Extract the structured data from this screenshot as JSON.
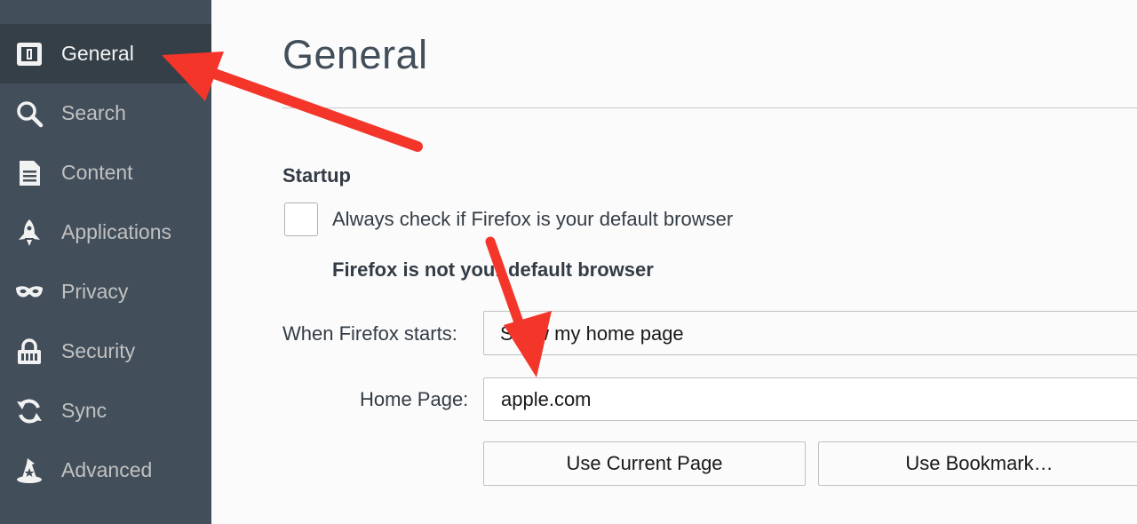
{
  "sidebar": {
    "items": [
      {
        "label": "General",
        "icon": "general-icon",
        "selected": true
      },
      {
        "label": "Search",
        "icon": "search-icon",
        "selected": false
      },
      {
        "label": "Content",
        "icon": "content-icon",
        "selected": false
      },
      {
        "label": "Applications",
        "icon": "rocket-icon",
        "selected": false
      },
      {
        "label": "Privacy",
        "icon": "mask-icon",
        "selected": false
      },
      {
        "label": "Security",
        "icon": "lock-icon",
        "selected": false
      },
      {
        "label": "Sync",
        "icon": "sync-icon",
        "selected": false
      },
      {
        "label": "Advanced",
        "icon": "wizard-hat-icon",
        "selected": false
      }
    ]
  },
  "main": {
    "title": "General",
    "startup": {
      "heading": "Startup",
      "default_check_label": "Always check if Firefox is your default browser",
      "default_checked": false,
      "default_status": "Firefox is not your default browser",
      "when_starts_label": "When Firefox starts:",
      "when_starts_value": "Show my home page",
      "home_page_label": "Home Page:",
      "home_page_value": "apple.com",
      "use_current_label": "Use Current Page",
      "use_bookmark_label": "Use Bookmark…"
    }
  },
  "annotations": {
    "arrow_color": "#f4352a",
    "arrows": [
      "pointing-to-general-nav",
      "pointing-to-home-page-field"
    ]
  },
  "colors": {
    "sidebar_bg": "#424e5a",
    "sidebar_selected_bg": "#343f48",
    "main_bg": "#fbfbfb"
  }
}
